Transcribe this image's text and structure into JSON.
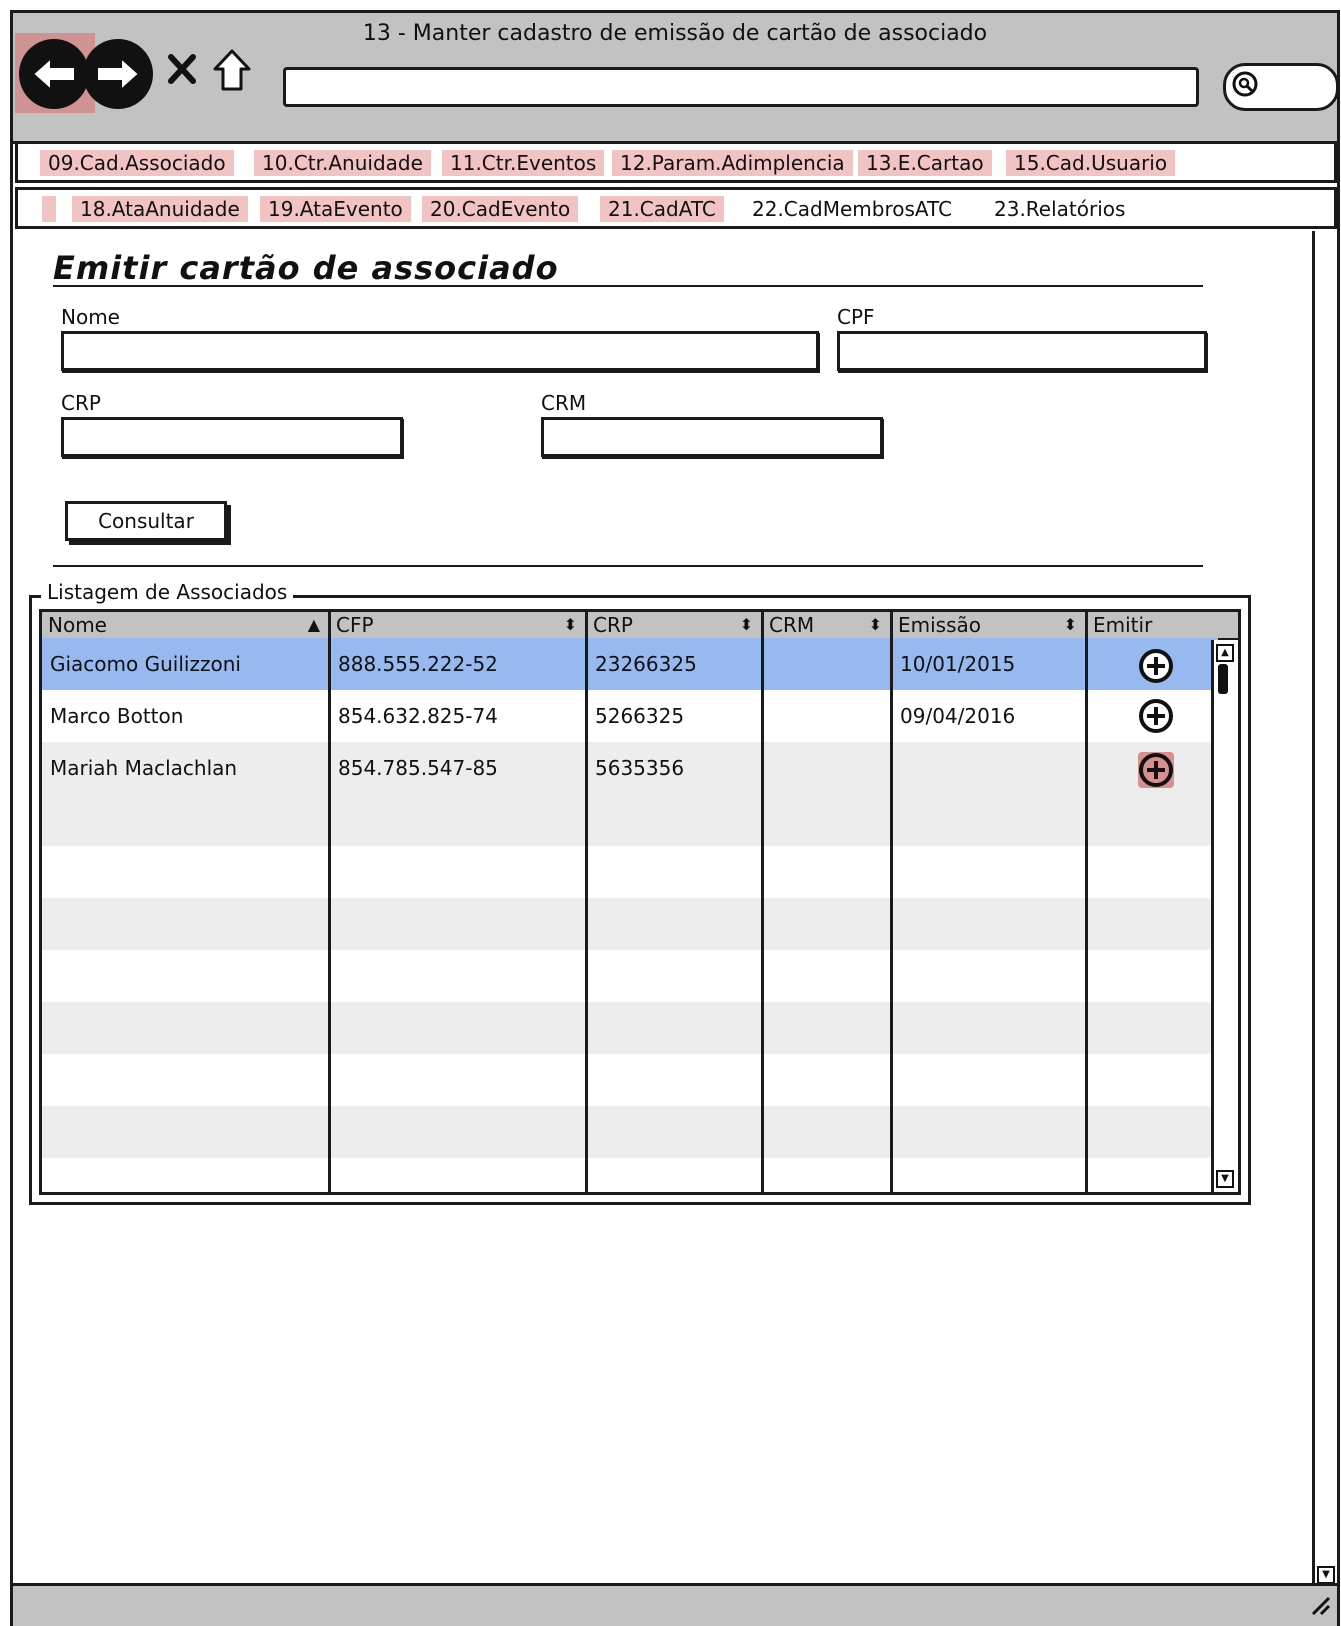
{
  "window": {
    "title": "13 - Manter cadastro de emissão de cartão de associado"
  },
  "menu_row1": [
    {
      "label": "09.Cad.Associado",
      "highlighted": true
    },
    {
      "label": "10.Ctr.Anuidade",
      "highlighted": true
    },
    {
      "label": "11.Ctr.Eventos",
      "highlighted": true
    },
    {
      "label": "12.Param.Adimplencia",
      "highlighted": true
    },
    {
      "label": "13.E.Cartao",
      "highlighted": true
    },
    {
      "label": "15.Cad.Usuario",
      "highlighted": true
    }
  ],
  "menu_row2": [
    {
      "label": "18.AtaAnuidade",
      "highlighted": true
    },
    {
      "label": "19.AtaEvento",
      "highlighted": true
    },
    {
      "label": "20.CadEvento",
      "highlighted": true
    },
    {
      "label": "21.CadATC",
      "highlighted": true
    },
    {
      "label": "22.CadMembrosATC",
      "highlighted": false
    },
    {
      "label": "23.Relatórios",
      "highlighted": false
    }
  ],
  "page": {
    "title": "Emitir cartão de associado",
    "fields": {
      "nome_label": "Nome",
      "nome_value": "",
      "cpf_label": "CPF",
      "cpf_value": "",
      "crp_label": "CRP",
      "crp_value": "",
      "crm_label": "CRM",
      "crm_value": ""
    },
    "consultar_label": "Consultar"
  },
  "listing": {
    "legend": "Listagem de Associados",
    "columns": [
      {
        "label": "Nome",
        "sort": "asc"
      },
      {
        "label": "CFP",
        "sort": "both"
      },
      {
        "label": "CRP",
        "sort": "both"
      },
      {
        "label": "CRM",
        "sort": "both"
      },
      {
        "label": "Emissão",
        "sort": "both"
      },
      {
        "label": "Emitir",
        "sort": "none"
      }
    ],
    "rows": [
      {
        "nome": "Giacomo Guilizzoni",
        "cfp": "888.555.222-52",
        "crp": "23266325",
        "crm": "",
        "emissao": "10/01/2015",
        "emitir_icon": "plus-circle-icon",
        "selected": true
      },
      {
        "nome": "Marco Botton",
        "cfp": "854.632.825-74",
        "crp": "5266325",
        "crm": "",
        "emissao": "09/04/2016",
        "emitir_icon": "plus-circle-icon",
        "selected": false
      },
      {
        "nome": "Mariah Maclachlan",
        "cfp": "854.785.547-85",
        "crp": "5635356",
        "crm": "",
        "emissao": "",
        "emitir_icon": "plus-circle-icon",
        "selected": false
      }
    ]
  },
  "colors": {
    "chrome": "#c2c2c2",
    "highlight": "#f2c3c3",
    "selected_row": "#97b9ef",
    "alt_row": "#ededed"
  }
}
